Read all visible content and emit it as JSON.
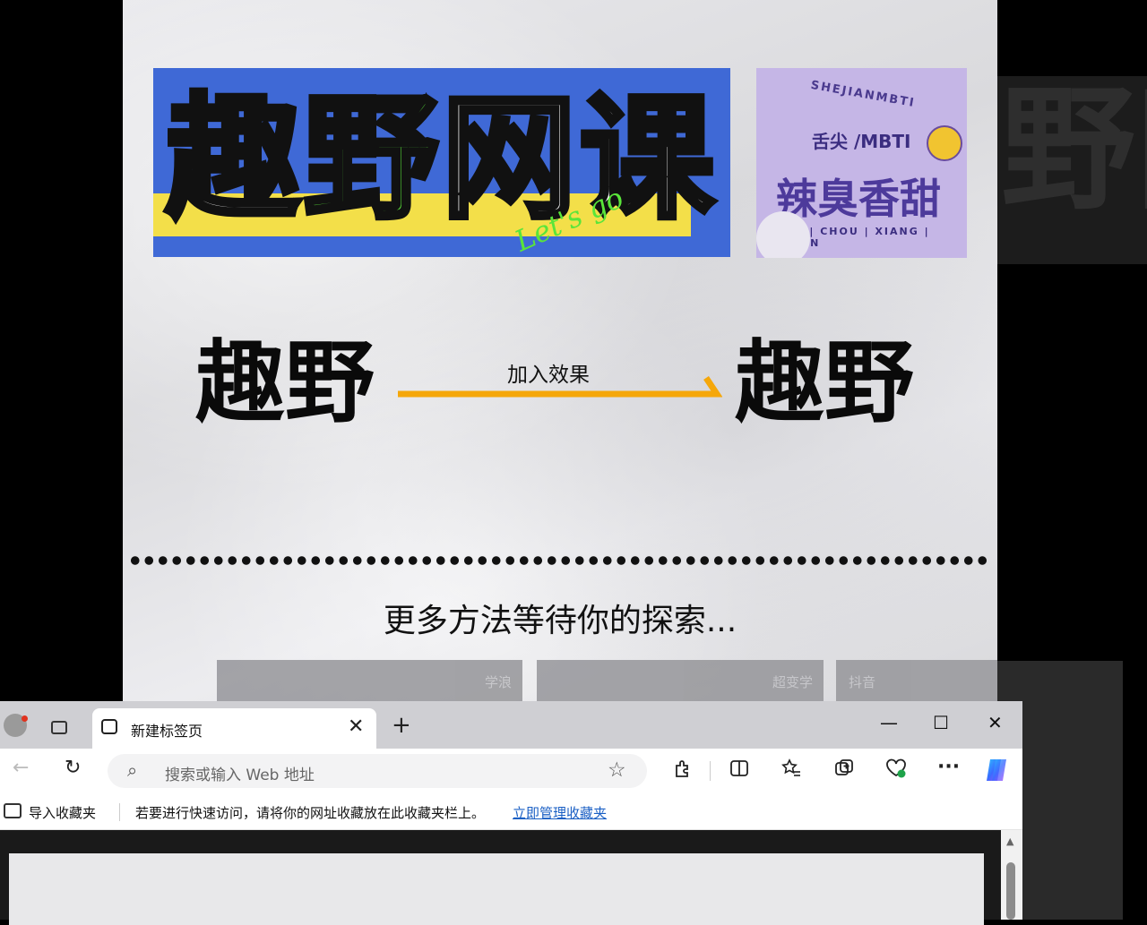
{
  "background": {
    "banner_title_chars": [
      "趣",
      "野",
      "网",
      "课"
    ],
    "banner_script": "Let's go",
    "badge": {
      "arc_text": "SHEJIANMBTI",
      "sub_text": "舌尖 /MBTI",
      "title": "辣臭香甜",
      "footer": "LA | CHOU | XIANG | TIAN"
    },
    "demo_before": "趣野",
    "demo_arrow_label": "加入效果",
    "demo_after": "趣野",
    "more_text": "更多方法等待你的探索...",
    "thumb_labels": [
      "学浪",
      "超变学",
      "抖音"
    ],
    "ghost_text": "野网"
  },
  "browser": {
    "tab_title": "新建标签页",
    "tab_close": "✕",
    "new_tab": "+",
    "window_buttons": {
      "minimize": "—",
      "maximize": "☐",
      "close": "✕"
    },
    "back": "←",
    "refresh": "↻",
    "search_icon": "⌕",
    "address_placeholder": "搜索或输入 Web 地址",
    "favorite_star": "☆",
    "toolbar_icons": [
      "extensions-icon",
      "split-screen-icon",
      "favorites-icon",
      "collections-icon",
      "performance-icon",
      "more-icon",
      "copilot-icon"
    ],
    "more_label": "···",
    "favbar": {
      "import_label": "导入收藏夹",
      "message": "若要进行快速访问，请将你的网址收藏放在此收藏夹栏上。",
      "manage_link": "立即管理收藏夹"
    },
    "accent_link_color": "#1a5fc4"
  },
  "colors": {
    "banner_blue": "#3f69d6",
    "banner_green": "#5ae53a",
    "banner_yellow": "#f3df49",
    "arrow_orange": "#f5a70a",
    "badge_purple": "#c5b6e6"
  }
}
